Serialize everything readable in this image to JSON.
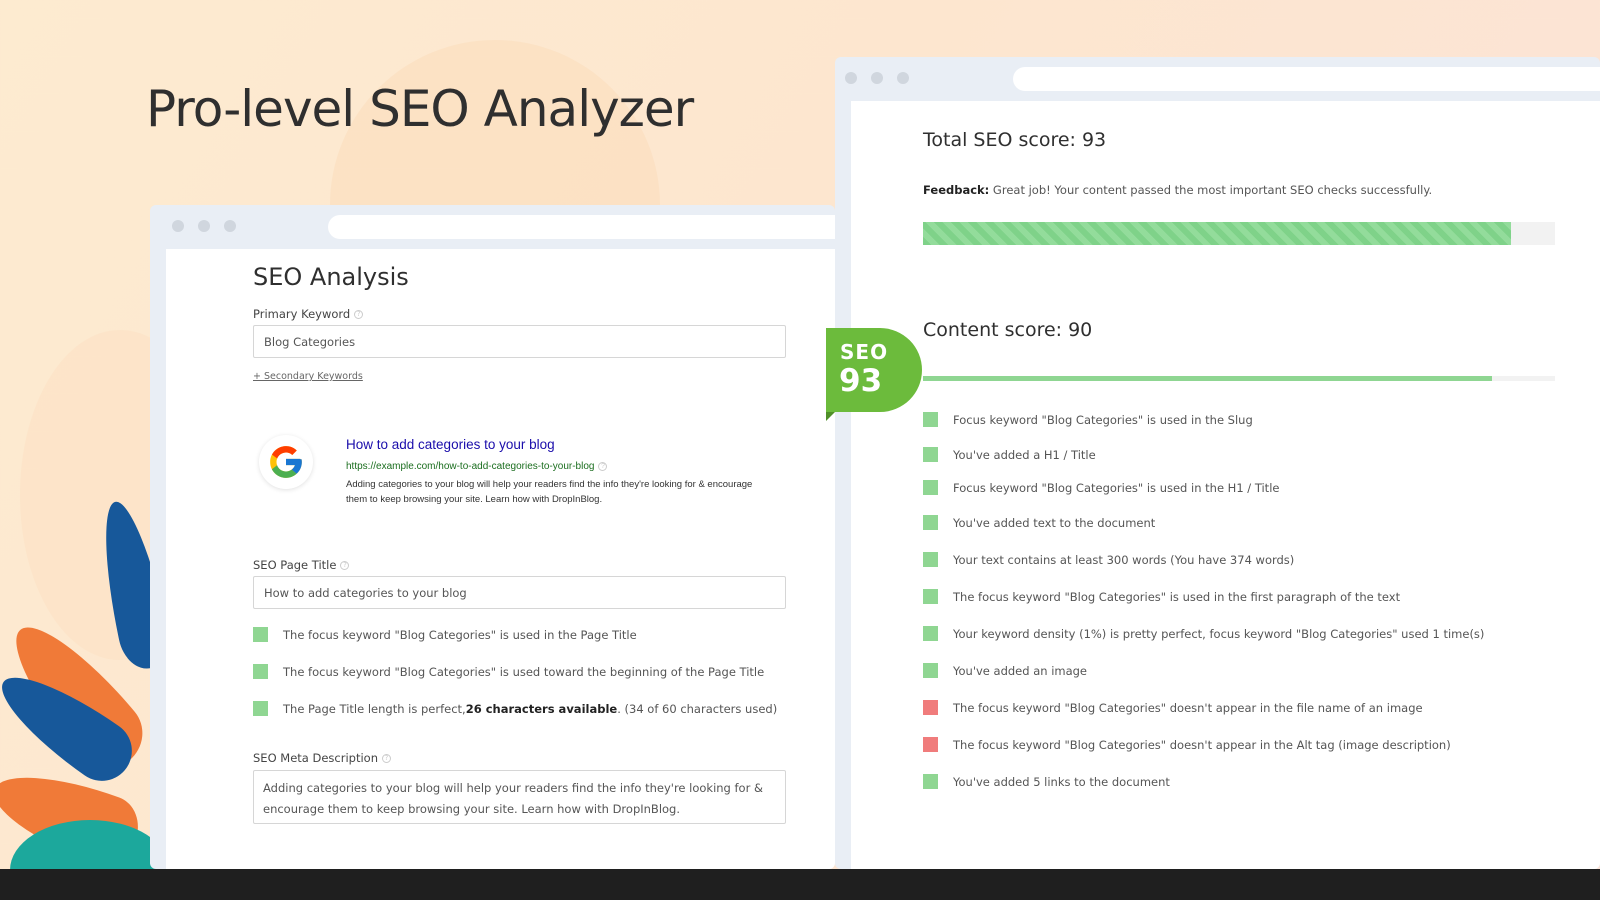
{
  "headline": "Pro-level SEO Analyzer",
  "colors": {
    "accent_green": "#8fd692",
    "badge_green": "#6cbb3c",
    "error_red": "#f07c7c",
    "serp_link": "#1a0dab",
    "serp_url": "#1b6e1f"
  },
  "seo_analysis": {
    "title": "SEO Analysis",
    "primary_keyword": {
      "label": "Primary Keyword",
      "value": "Blog Categories"
    },
    "secondary_link": "+ Secondary Keywords",
    "serp_preview": {
      "icon": "google-logo",
      "title": "How to add categories to your blog",
      "url": "https://example.com/how-to-add-categories-to-your-blog",
      "description": "Adding categories to your blog will help your readers find the info they're looking for & encourage them to keep browsing your site. Learn how with DropInBlog."
    },
    "page_title": {
      "label": "SEO Page Title",
      "value": "How to add categories to your blog"
    },
    "title_checks": [
      {
        "status": "ok",
        "text": "The focus keyword \"Blog Categories\" is used in the Page Title"
      },
      {
        "status": "ok",
        "text": "The focus keyword \"Blog Categories\" is used toward the beginning of the Page Title"
      },
      {
        "status": "ok",
        "prefix": "The Page Title length is perfect, ",
        "bold": "26 characters available",
        "suffix": ". (34 of 60 characters used)"
      }
    ],
    "meta_description": {
      "label": "SEO Meta Description",
      "value": "Adding categories to your blog will help your readers find the info they're looking for & encourage them to keep browsing your site. Learn how with DropInBlog."
    }
  },
  "badge": {
    "label": "SEO",
    "value": "93"
  },
  "scores": {
    "total_title": "Total SEO score: 93",
    "total_value": 93,
    "feedback_label": "Feedback:",
    "feedback_text": " Great job! Your content passed the most important SEO checks successfully.",
    "content_title": "Content score: 90",
    "content_value": 90
  },
  "content_checks": [
    {
      "status": "ok",
      "text": "Focus keyword \"Blog Categories\" is used in the Slug"
    },
    {
      "status": "ok",
      "text": "You've added a H1 / Title"
    },
    {
      "status": "ok",
      "text": "Focus keyword \"Blog Categories\" is used in the H1 / Title"
    },
    {
      "status": "ok",
      "text": "You've added text to the document"
    },
    {
      "status": "ok",
      "text": "Your text contains at least 300 words (You have 374 words)"
    },
    {
      "status": "ok",
      "text": "The focus keyword \"Blog Categories\" is used in the first paragraph of the text"
    },
    {
      "status": "ok",
      "text": "Your keyword density (1%) is pretty perfect, focus keyword \"Blog Categories\" used 1 time(s)"
    },
    {
      "status": "ok",
      "text": "You've added an image"
    },
    {
      "status": "bad",
      "text": "The focus keyword \"Blog Categories\" doesn't appear in the file name of an image"
    },
    {
      "status": "bad",
      "text": "The focus keyword \"Blog Categories\" doesn't appear in the Alt tag (image description)"
    },
    {
      "status": "ok",
      "text": "You've added 5 links to the document"
    }
  ]
}
